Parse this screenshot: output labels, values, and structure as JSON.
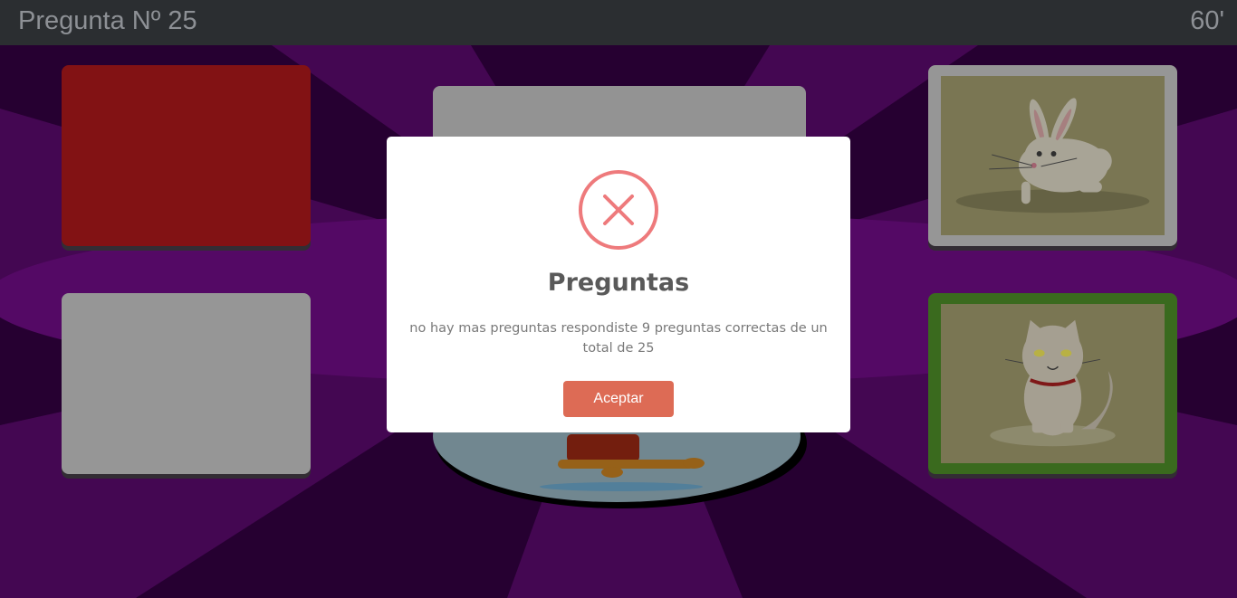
{
  "header": {
    "question_label": "Pregunta Nº 25",
    "timer": "60'"
  },
  "cards": {
    "top_left": {
      "color": "#8e1416"
    },
    "bottom_left": {
      "color": "#a3a3a3"
    },
    "top_right": {
      "image": "rabbit-icon"
    },
    "bottom_right": {
      "image": "cat-icon",
      "border_color": "#3f7421"
    }
  },
  "modal": {
    "icon": "error-x-icon",
    "title": "Preguntas",
    "message": "no hay mas preguntas respondiste 9 preguntas correctas de un total de 25",
    "button_label": "Aceptar",
    "accent_color": "#dd6b55"
  }
}
